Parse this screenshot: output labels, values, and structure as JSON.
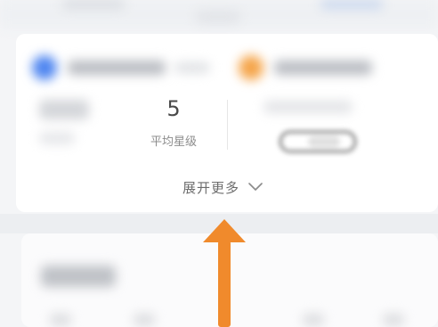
{
  "stats": {
    "rating_value": "5",
    "rating_label": "平均星级"
  },
  "expand": {
    "label": "展开更多",
    "icon": "chevron-down-icon"
  },
  "annotation": {
    "arrow_color": "#f08a2c",
    "arrow_icon": "up-arrow-icon"
  },
  "colors": {
    "accent_blue": "#4f86f0",
    "accent_orange": "#f5a54a"
  }
}
